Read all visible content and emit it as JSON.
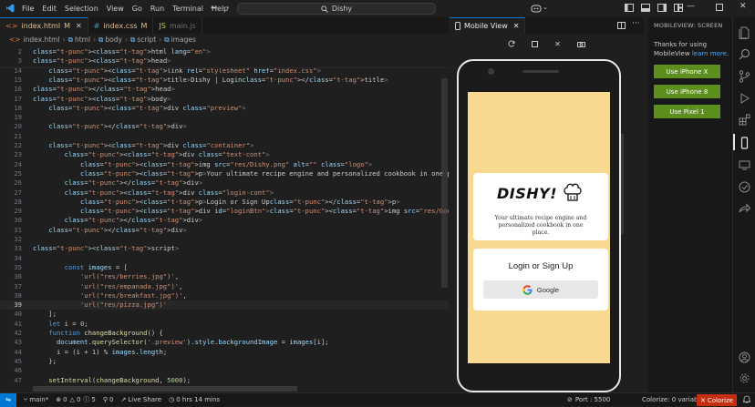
{
  "menu": [
    "File",
    "Edit",
    "Selection",
    "View",
    "Go",
    "Run",
    "Terminal",
    "Help"
  ],
  "search_text": "Dishy",
  "tabs": [
    {
      "label": "index.html",
      "badge": "M",
      "active": true
    },
    {
      "label": "index.css",
      "badge": "M",
      "active": false
    },
    {
      "label": "main.js",
      "badge": "",
      "active": false
    }
  ],
  "breadcrumb": [
    "index.html",
    "html",
    "body",
    "script",
    "images"
  ],
  "code_lines": [
    {
      "n": "2",
      "text": "<html lang=\"en\">"
    },
    {
      "n": "3",
      "text": "<head>"
    },
    {
      "n": "14",
      "text": "    <link rel=\"stylesheet\" href=\"index.css\">"
    },
    {
      "n": "15",
      "text": "    <title>Dishy | Login</title>"
    },
    {
      "n": "16",
      "text": "</head>"
    },
    {
      "n": "17",
      "text": "<body>"
    },
    {
      "n": "18",
      "text": "    <div class=\"preview\">"
    },
    {
      "n": "19",
      "text": ""
    },
    {
      "n": "20",
      "text": "    </div>"
    },
    {
      "n": "21",
      "text": ""
    },
    {
      "n": "22",
      "text": "    <div class=\"container\">"
    },
    {
      "n": "23",
      "text": "        <div class=\"text-cont\">"
    },
    {
      "n": "24",
      "text": "            <img src=\"res/Dishy.png\" alt=\"\" class=\"logo\">"
    },
    {
      "n": "25",
      "text": "            <p>Your ultimate recipe engine and personalized cookbook in one place.</p>"
    },
    {
      "n": "26",
      "text": "        </div>"
    },
    {
      "n": "27",
      "text": "        <div class=\"login-cont\">"
    },
    {
      "n": "28",
      "text": "            <p>Login or Sign Up</p>"
    },
    {
      "n": "29",
      "text": "            <div id=\"loginBtn\"><img src=\"res/Google__G__logo.svg.webp\" alt=\"\" class=\"google\">Google</div>"
    },
    {
      "n": "30",
      "text": "        </div>"
    },
    {
      "n": "31",
      "text": "    </div>"
    },
    {
      "n": "32",
      "text": ""
    },
    {
      "n": "33",
      "text": "<script>"
    },
    {
      "n": "34",
      "text": ""
    },
    {
      "n": "35",
      "text": "        const images = ["
    },
    {
      "n": "36",
      "text": "            'url(\"res/berries.jpg\")',"
    },
    {
      "n": "37",
      "text": "            'url(\"res/empanada.jpg\")',"
    },
    {
      "n": "38",
      "text": "            'url(\"res/breakfast.jpg\")',"
    },
    {
      "n": "39",
      "text": "            'url(\"res/pizza.jpg\")'"
    },
    {
      "n": "40",
      "text": "    ];"
    },
    {
      "n": "41",
      "text": "    let i = 0;"
    },
    {
      "n": "42",
      "text": "    function changeBackground() {"
    },
    {
      "n": "43",
      "text": "      document.querySelector('.preview').style.backgroundImage = images[i];"
    },
    {
      "n": "44",
      "text": "      i = (i + 1) % images.length;"
    },
    {
      "n": "45",
      "text": "    };"
    },
    {
      "n": "46",
      "text": ""
    },
    {
      "n": "47",
      "text": "    setInterval(changeBackground, 5000);"
    }
  ],
  "mobile_view": {
    "tab_label": "Mobile View",
    "app": {
      "logo_text": "DISHY!",
      "tagline": "Your ultimate recipe engine and personalized cookbook in one place.",
      "login_title": "Login or Sign Up",
      "google_label": "Google"
    }
  },
  "mobileview_sidebar": {
    "title": "MOBILEVIEW: SCREEN",
    "thanks_text": "Thanks for using MobileView",
    "learn_more": "learn more",
    "buttons": [
      "Use iPhone X",
      "Use iPhone 8",
      "Use Pixel 1"
    ]
  },
  "statusbar": {
    "branch": "main*",
    "errors": "0",
    "warnings": "0",
    "info": "5",
    "ports": "0",
    "live_share": "Live Share",
    "time": "0 hrs 14 mins",
    "port": "Port : 5500",
    "colorize_vars": "Colorize: 0 variables",
    "colorize_btn": "Colorize"
  },
  "colors": {
    "accent": "#0078d4",
    "mobileview_button": "#5c8f1e",
    "app_background": "#f7d990",
    "colorize_button": "#c72e0f"
  }
}
